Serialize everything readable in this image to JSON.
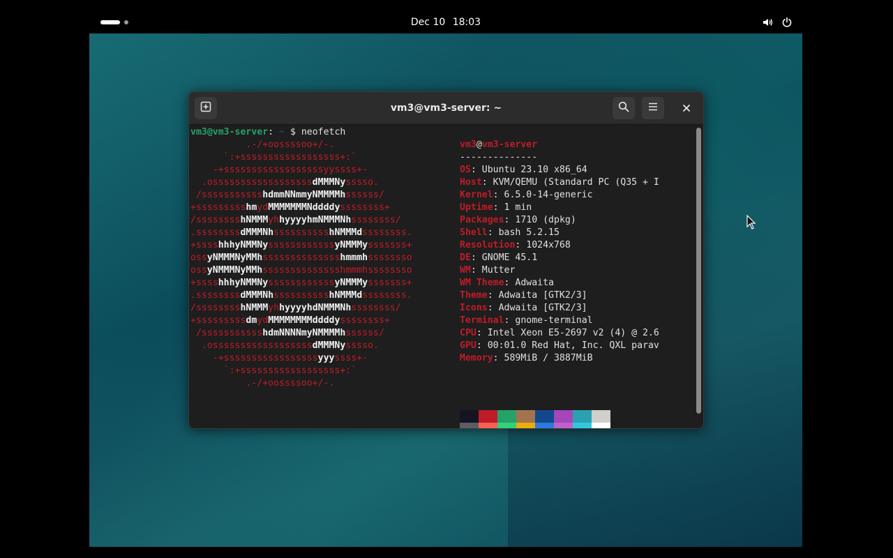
{
  "topbar": {
    "date": "Dec 10",
    "time": "18:03",
    "icons": [
      "activities-indicator",
      "volume-icon",
      "power-icon"
    ]
  },
  "terminal": {
    "title": "vm3@vm3-server: ~",
    "header_icons": [
      "new-tab-icon",
      "search-icon",
      "hamburger-menu-icon",
      "close-icon"
    ],
    "prompt": {
      "user_host": "vm3@vm3-server",
      "sep": ":",
      "path": " ~",
      "dollar": " $ ",
      "command": "neofetch"
    },
    "logo": [
      [
        [
          "red",
          "          .-/+oossssoo+/-."
        ]
      ],
      [
        [
          "red",
          "      `:+ssssssssssssssssss+:`"
        ]
      ],
      [
        [
          "red",
          "    -+ssssssssssssssssssyyssss+-"
        ]
      ],
      [
        [
          "red",
          "  .ossssssssssssssssss"
        ],
        [
          "white",
          "dMMMNy"
        ],
        [
          "red",
          "sssso."
        ]
      ],
      [
        [
          "red",
          " /sssssssssss"
        ],
        [
          "white",
          "hdmmNNmmyNMMMMh"
        ],
        [
          "red",
          "ssssss/"
        ]
      ],
      [
        [
          "red",
          "+sssssssss"
        ],
        [
          "white",
          "hm"
        ],
        [
          "red",
          "yd"
        ],
        [
          "white",
          "MMMMMMMNddddy"
        ],
        [
          "red",
          "ssssssss+"
        ]
      ],
      [
        [
          "red",
          "/ssssssss"
        ],
        [
          "white",
          "hNMMM"
        ],
        [
          "red",
          "yh"
        ],
        [
          "white",
          "hyyyyhmNMMMNh"
        ],
        [
          "red",
          "ssssssss/"
        ]
      ],
      [
        [
          "red",
          ".ssssssss"
        ],
        [
          "white",
          "dMMMNh"
        ],
        [
          "red",
          "ssssssssss"
        ],
        [
          "white",
          "hNMMMd"
        ],
        [
          "red",
          "ssssssss."
        ]
      ],
      [
        [
          "red",
          "+ssss"
        ],
        [
          "white",
          "hhhyNMMNy"
        ],
        [
          "red",
          "ssssssssssss"
        ],
        [
          "white",
          "yNMMMy"
        ],
        [
          "red",
          "sssssss+"
        ]
      ],
      [
        [
          "red",
          "oss"
        ],
        [
          "white",
          "yNMMMNyMMh"
        ],
        [
          "red",
          "ssssssssssssss"
        ],
        [
          "white",
          "hmmmh"
        ],
        [
          "red",
          "ssssssso"
        ]
      ],
      [
        [
          "red",
          "oss"
        ],
        [
          "white",
          "yNMMMNyMMh"
        ],
        [
          "red",
          "sssssssssssssshmmmhssssssso"
        ]
      ],
      [
        [
          "red",
          "+ssss"
        ],
        [
          "white",
          "hhhyNMMNy"
        ],
        [
          "red",
          "ssssssssssss"
        ],
        [
          "white",
          "yNMMMy"
        ],
        [
          "red",
          "sssssss+"
        ]
      ],
      [
        [
          "red",
          ".ssssssss"
        ],
        [
          "white",
          "dMMMNh"
        ],
        [
          "red",
          "ssssssssss"
        ],
        [
          "white",
          "hNMMMd"
        ],
        [
          "red",
          "ssssssss."
        ]
      ],
      [
        [
          "red",
          "/ssssssss"
        ],
        [
          "white",
          "hNMMM"
        ],
        [
          "red",
          "yh"
        ],
        [
          "white",
          "hyyyyhdNMMMNh"
        ],
        [
          "red",
          "ssssssss/"
        ]
      ],
      [
        [
          "red",
          "+sssssssss"
        ],
        [
          "white",
          "dm"
        ],
        [
          "red",
          "yd"
        ],
        [
          "white",
          "MMMMMMMMddddy"
        ],
        [
          "red",
          "ssssssss+"
        ]
      ],
      [
        [
          "red",
          " /sssssssssss"
        ],
        [
          "white",
          "hdmNNNNmyNMMMMh"
        ],
        [
          "red",
          "ssssss/"
        ]
      ],
      [
        [
          "red",
          "  .ossssssssssssssssss"
        ],
        [
          "white",
          "dMMMNy"
        ],
        [
          "red",
          "sssso."
        ]
      ],
      [
        [
          "red",
          "    -+sssssssssssssssss"
        ],
        [
          "white",
          "yyy"
        ],
        [
          "red",
          "ssss+-"
        ]
      ],
      [
        [
          "red",
          "      `:+ssssssssssssssssss+:`"
        ]
      ],
      [
        [
          "red",
          "          .-/+oossssoo+/-."
        ]
      ]
    ],
    "info_header": {
      "user": "vm3",
      "at": "@",
      "host": "vm3-server"
    },
    "info_divider": "--------------",
    "info": [
      {
        "key": "OS",
        "value": "Ubuntu 23.10 x86_64"
      },
      {
        "key": "Host",
        "value": "KVM/QEMU (Standard PC (Q35 + I"
      },
      {
        "key": "Kernel",
        "value": "6.5.0-14-generic"
      },
      {
        "key": "Uptime",
        "value": "1 min"
      },
      {
        "key": "Packages",
        "value": "1710 (dpkg)"
      },
      {
        "key": "Shell",
        "value": "bash 5.2.15"
      },
      {
        "key": "Resolution",
        "value": "1024x768"
      },
      {
        "key": "DE",
        "value": "GNOME 45.1"
      },
      {
        "key": "WM",
        "value": "Mutter"
      },
      {
        "key": "WM Theme",
        "value": "Adwaita"
      },
      {
        "key": "Theme",
        "value": "Adwaita [GTK2/3]"
      },
      {
        "key": "Icons",
        "value": "Adwaita [GTK2/3]"
      },
      {
        "key": "Terminal",
        "value": "gnome-terminal"
      },
      {
        "key": "CPU",
        "value": "Intel Xeon E5-2697 v2 (4) @ 2.6"
      },
      {
        "key": "GPU",
        "value": "00:01.0 Red Hat, Inc. QXL parav"
      },
      {
        "key": "Memory",
        "value": "589MiB / 3887MiB"
      }
    ],
    "palette": [
      "#171421",
      "#c01c28",
      "#26a269",
      "#a2734c",
      "#12488b",
      "#a347ba",
      "#2aa1b3",
      "#d0cfcc",
      "#5e5c64",
      "#f66151",
      "#33d17a",
      "#e9ad0c",
      "#2a7bde",
      "#c061cb",
      "#33c7de",
      "#ffffff"
    ]
  }
}
